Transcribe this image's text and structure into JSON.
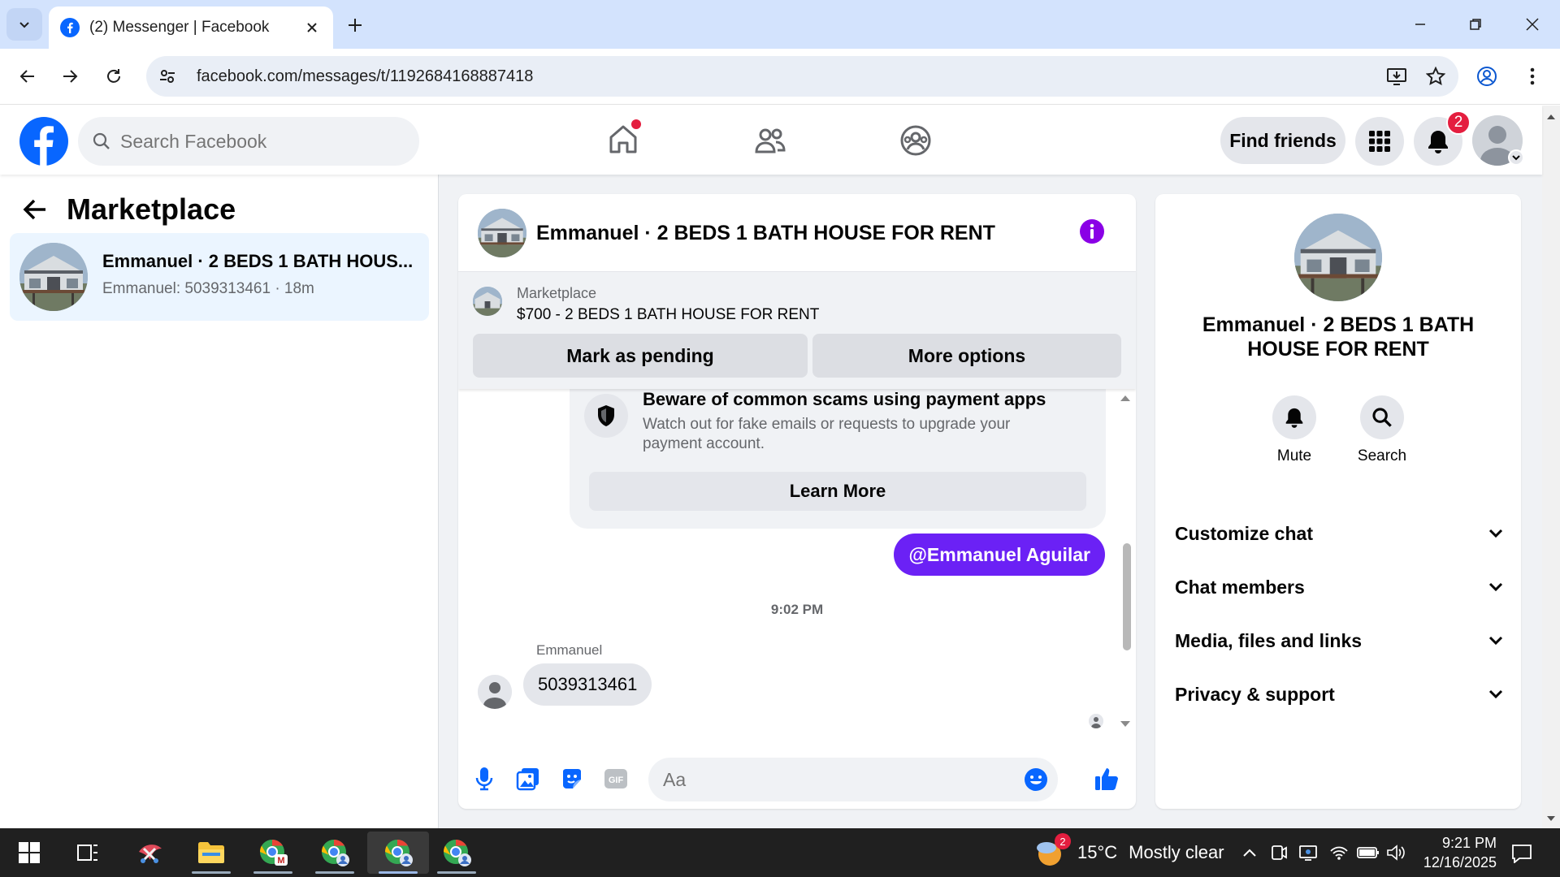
{
  "browser": {
    "tab_title": "(2) Messenger | Facebook",
    "url": "facebook.com/messages/t/1192684168887418"
  },
  "fb_header": {
    "search_placeholder": "Search Facebook",
    "find_friends_label": "Find friends",
    "notification_count": "2"
  },
  "left_panel": {
    "title": "Marketplace",
    "conversations": [
      {
        "name": "Emmanuel · 2 BEDS 1 BATH HOUS...",
        "preview": "Emmanuel: 5039313461 · 18m"
      }
    ]
  },
  "chat": {
    "title": "Emmanuel · 2 BEDS 1 BATH HOUSE FOR RENT",
    "listing": {
      "label": "Marketplace",
      "price_title": "$700 - 2 BEDS 1 BATH HOUSE FOR RENT",
      "mark_pending_label": "Mark as pending",
      "more_options_label": "More options"
    },
    "scam_notice": {
      "title": "Beware of common scams using payment apps",
      "body": "Watch out for fake emails or requests to upgrade your payment account.",
      "button_label": "Learn More"
    },
    "sent_message": "@Emmanuel Aguilar",
    "timestamp": "9:02 PM",
    "sender_name": "Emmanuel",
    "received_message": "5039313461",
    "composer_placeholder": "Aa"
  },
  "right_panel": {
    "name": "Emmanuel · 2 BEDS 1 BATH HOUSE FOR RENT",
    "actions": {
      "mute_label": "Mute",
      "search_label": "Search"
    },
    "sections": [
      "Customize chat",
      "Chat members",
      "Media, files and links",
      "Privacy & support"
    ]
  },
  "taskbar": {
    "weather_temp": "15°C",
    "weather_desc": "Mostly clear",
    "weather_badge": "2",
    "time": "9:21 PM",
    "date": "12/16/2025"
  },
  "colors": {
    "facebook_blue": "#0866ff",
    "messenger_purple": "#6b21f5",
    "notification_red": "#e41e3f",
    "chrome_tab_bg": "#d3e3fd"
  }
}
